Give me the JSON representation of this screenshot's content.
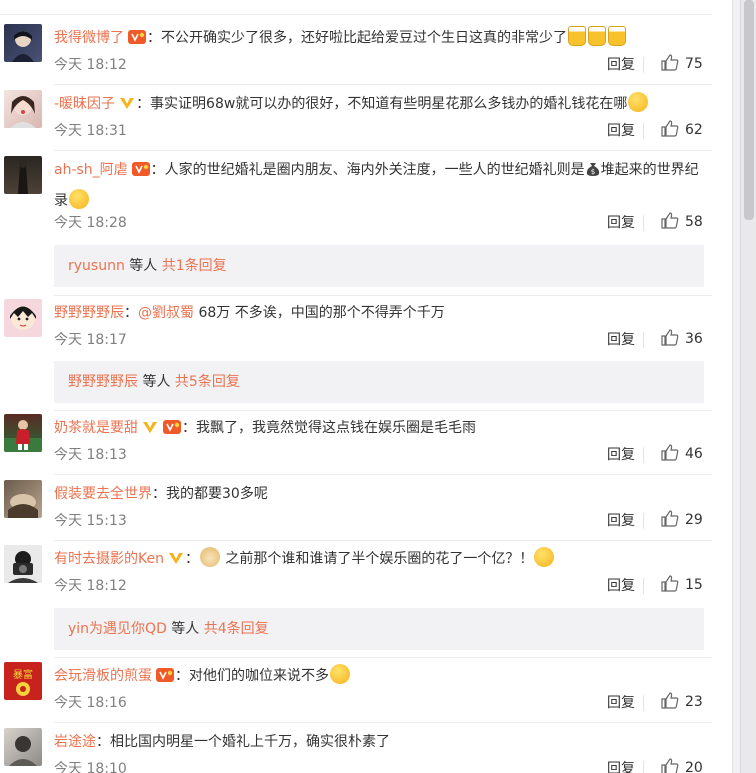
{
  "comments": [
    {
      "user": "我得微博了",
      "badges": [
        "vip"
      ],
      "text": "：不公开确实少了很多，还好啦比起给爱豆过个生日这真的非常少了",
      "emoji_after": [
        "beer",
        "beer",
        "beer"
      ],
      "time": "今天 18:12",
      "reply_label": "回复",
      "likes": "75"
    },
    {
      "user": "-暖昧因子",
      "badges": [
        "verified"
      ],
      "text": "：事实证明68w就可以办的很好，不知道有些明星花那么多钱办的婚礼钱花在哪",
      "emoji_after": [
        "sweat"
      ],
      "time": "今天 18:31",
      "reply_label": "回复",
      "likes": "62"
    },
    {
      "user": "ah-sh_阿虐",
      "badges": [
        "vip"
      ],
      "text": "：人家的世纪婚礼是圈内朋友、海内外关注度，一些人的世纪婚礼则是",
      "text_after_bag": "堆起来的世界纪录",
      "emoji_after": [
        "cry-laugh"
      ],
      "time": "今天 18:28",
      "reply_label": "回复",
      "likes": "58",
      "subreply": {
        "user": "ryusunn",
        "suffix": " 等人 ",
        "total": "共1条回复"
      }
    },
    {
      "user": "野野野野辰",
      "badges": [],
      "text_pre": "：",
      "mention": "@劉叔蜀",
      "text": " 68万 不多诶，中国的那个不得弄个千万",
      "time": "今天 18:17",
      "reply_label": "回复",
      "likes": "36",
      "subreply": {
        "user": "野野野野辰",
        "suffix": " 等人 ",
        "total": "共5条回复"
      }
    },
    {
      "user": "奶茶就是要甜",
      "badges": [
        "verified",
        "vip"
      ],
      "text": "：我飘了，我竟然觉得这点钱在娱乐圈是毛毛雨",
      "time": "今天 18:13",
      "reply_label": "回复",
      "likes": "46"
    },
    {
      "user": "假装要去全世界",
      "badges": [],
      "text": "：我的都要30多呢",
      "time": "今天 15:13",
      "reply_label": "回复",
      "likes": "29"
    },
    {
      "user": "有时去摄影的Ken",
      "badges": [
        "verified"
      ],
      "text_pre": "：",
      "emoji_before": [
        "doge"
      ],
      "text": " 之前那个谁和谁请了半个娱乐圈的花了一个亿？！",
      "emoji_after": [
        "cry-laugh"
      ],
      "time": "今天 18:12",
      "reply_label": "回复",
      "likes": "15",
      "subreply": {
        "user": "yin为遇见你QD",
        "suffix": " 等人 ",
        "total": "共4条回复"
      }
    },
    {
      "user": "会玩滑板的煎蛋",
      "badges": [
        "vip"
      ],
      "text": "：对他们的咖位来说不多",
      "emoji_after": [
        "smile"
      ],
      "time": "今天 18:16",
      "reply_label": "回复",
      "likes": "23"
    },
    {
      "user": "岩途途",
      "badges": [],
      "text": "：相比国内明星一个婚礼上千万，确实很朴素了",
      "time": "今天 18:10",
      "reply_label": "回复",
      "likes": "20"
    }
  ],
  "colors": {
    "link": "#eb7350",
    "verified": "#f6b31a",
    "vip": "#f05a28"
  }
}
